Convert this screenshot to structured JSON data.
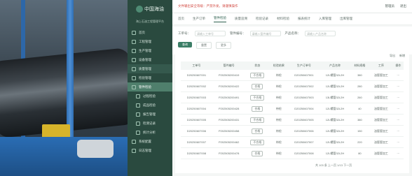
{
  "brand": {
    "name": "中国海油",
    "en": "CNOOC",
    "system_title": "海上石油工程管理平台"
  },
  "top": {
    "warning": "文件输出安全等级：严禁外发，请谨慎操作",
    "user_label": "管理员",
    "logout": "退出"
  },
  "sidebar": {
    "items": [
      {
        "label": "首页",
        "state": "normal"
      },
      {
        "label": "工程管理",
        "state": "normal"
      },
      {
        "label": "生产管理",
        "state": "normal"
      },
      {
        "label": "设备管理",
        "state": "normal"
      },
      {
        "label": "质量管理",
        "state": "active"
      },
      {
        "label": "检验管理",
        "state": "normal"
      },
      {
        "label": "管件检验",
        "state": "selected"
      },
      {
        "label": "过程检验",
        "state": "sub"
      },
      {
        "label": "成品检验",
        "state": "sub"
      },
      {
        "label": "报告管理",
        "state": "sub"
      },
      {
        "label": "检测记录",
        "state": "sub"
      },
      {
        "label": "统计分析",
        "state": "sub"
      },
      {
        "label": "系统配置",
        "state": "normal"
      },
      {
        "label": "日志管理",
        "state": "normal"
      }
    ]
  },
  "tabs": [
    "首页",
    "生产订单",
    "管件检验",
    "质量追溯",
    "检验记录",
    "材料检验",
    "报表统计",
    "入库管理",
    "出库管理"
  ],
  "filters": {
    "label1": "工单号：",
    "placeholder1": "请输入工单号",
    "label2": "管件编号：",
    "placeholder2": "请输入管件编号",
    "label3": "产品名称：",
    "placeholder3": "请输入产品名称",
    "search": "查询",
    "reset": "重置",
    "more": "更多"
  },
  "table_actions": {
    "export": "导出",
    "add": "新增"
  },
  "columns": [
    "工单号",
    "管件编号",
    "状态",
    "检验结果",
    "生产订单号",
    "产品名称",
    "材料规格",
    "工序",
    "操作"
  ],
  "rows": [
    [
      "D20250607001",
      "P202505200419",
      "不合格",
      "待检",
      "D20250607001",
      "12L螺管32L2H",
      "380",
      "油管管加工",
      "···"
    ],
    [
      "D20250607002",
      "P202505200422",
      "合格",
      "待检",
      "D20250607002",
      "12L螺管32L2H",
      "280",
      "油管管加工",
      "···"
    ],
    [
      "D20250607003",
      "P202505200491",
      "不合格",
      "待检",
      "D20250607003",
      "13L螺管32L2H",
      "260",
      "油管管加工",
      "···"
    ],
    [
      "D20250607004",
      "P202505200428",
      "合格",
      "待检",
      "D20250607004",
      "12L螺管32L2H",
      "40",
      "油管管加工",
      "···"
    ],
    [
      "D20250607005",
      "P202505200431",
      "不合格",
      "待检",
      "D20250607005",
      "12L螺管32L2H",
      "380",
      "油管管加工",
      "···"
    ],
    [
      "D20250607006",
      "P202505200458",
      "合格",
      "待检",
      "D20250607006",
      "12L螺管32L2H",
      "150",
      "油管管加工",
      "···"
    ],
    [
      "D20250607007",
      "P202505200462",
      "不合格",
      "待检",
      "D20250607007",
      "12L螺管32L2H",
      "220",
      "油管管加工",
      "···"
    ],
    [
      "D20250607008",
      "P202505200478",
      "合格",
      "待检",
      "D20250607008",
      "12L螺管32L2H",
      "80",
      "油管管加工",
      "···"
    ]
  ],
  "pager": {
    "summary": "共 103 条",
    "page": "1/13",
    "prev": "上一页",
    "next": "下一页"
  }
}
